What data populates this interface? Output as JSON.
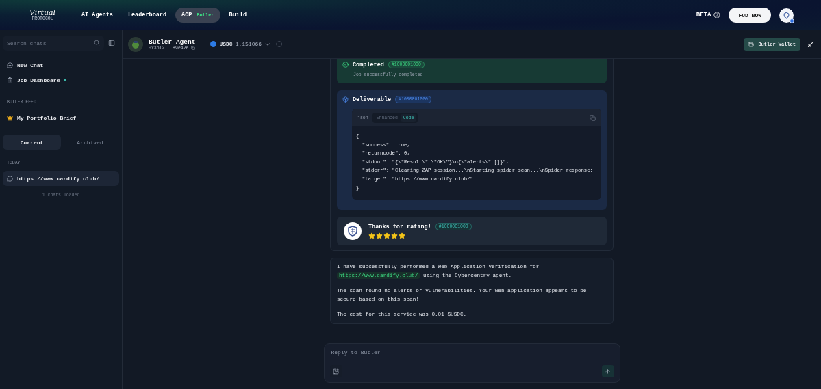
{
  "header": {
    "logo": {
      "script": "Virtual",
      "subtitle": "PROTOCOL"
    },
    "nav": [
      {
        "label": "AI Agents",
        "selected": false
      },
      {
        "label": "Leaderboard",
        "selected": false
      },
      {
        "label": "ACP",
        "badge": "Butler",
        "selected": true
      },
      {
        "label": "Build",
        "selected": false
      }
    ],
    "beta_label": "BETA",
    "cta_button": "FUD NOW"
  },
  "sidebar": {
    "search": {
      "placeholder": "Search chats"
    },
    "items": [
      {
        "label": "New Chat",
        "kind": "new-chat",
        "dot": false
      },
      {
        "label": "Job Dashboard",
        "kind": "dashboard",
        "dot": true
      }
    ],
    "feed_heading": "BUTLER FEED",
    "feed_items": [
      {
        "label": "My Portfolio Brief"
      }
    ],
    "tabs": [
      {
        "label": "Current",
        "selected": true
      },
      {
        "label": "Archived",
        "selected": false
      }
    ],
    "group_heading": "TODAY",
    "chats": [
      {
        "title": "https://www.cardify.club/",
        "selected": true
      }
    ],
    "footer": "1 chats loaded"
  },
  "chat_header": {
    "agent_name": "Butler Agent",
    "address": "0x3612...89e42e",
    "token": "USDC",
    "balance": "1.151066",
    "wallet_button": "Butler Wallet"
  },
  "job": {
    "completed": {
      "title": "Completed",
      "job_id": "#1000001000",
      "subtitle": "Job successfully completed"
    },
    "deliverable": {
      "title": "Deliverable",
      "job_id": "#1000001000",
      "format": "json",
      "view_tabs": [
        {
          "label": "Enhanced",
          "selected": false
        },
        {
          "label": "Code",
          "selected": true
        }
      ],
      "code_lines": [
        "{",
        "  \"success\": true,",
        "  \"returncode\": 0,",
        "  \"stdout\": \"{\\\"Result\\\":\\\"OK\\\"}\\n{\\\"alerts\\\":[]}\",",
        "  \"stderr\": \"Clearing ZAP session...\\nStarting spider scan...\\nSpider response:",
        "  \"target\": \"https://www.cardify.club/\"",
        "}"
      ]
    },
    "rating": {
      "title": "Thanks for rating!",
      "job_id": "#1000001000",
      "stars": 5
    }
  },
  "reply": {
    "paragraphs": [
      [
        {
          "kind": "text",
          "text": "I have successfully performed a Web Application Verification for "
        },
        {
          "kind": "code",
          "text": "https://www.cardify.club/"
        },
        {
          "kind": "text",
          "text": " using the Cybercentry agent."
        }
      ],
      [
        {
          "kind": "text",
          "text": "The scan found no alerts or vulnerabilities. Your web application appears to be secure based on this scan!"
        }
      ],
      [
        {
          "kind": "text",
          "text": "The cost for this service was 0.01 $USDC."
        }
      ]
    ]
  },
  "composer": {
    "placeholder": "Reply to Butler"
  }
}
